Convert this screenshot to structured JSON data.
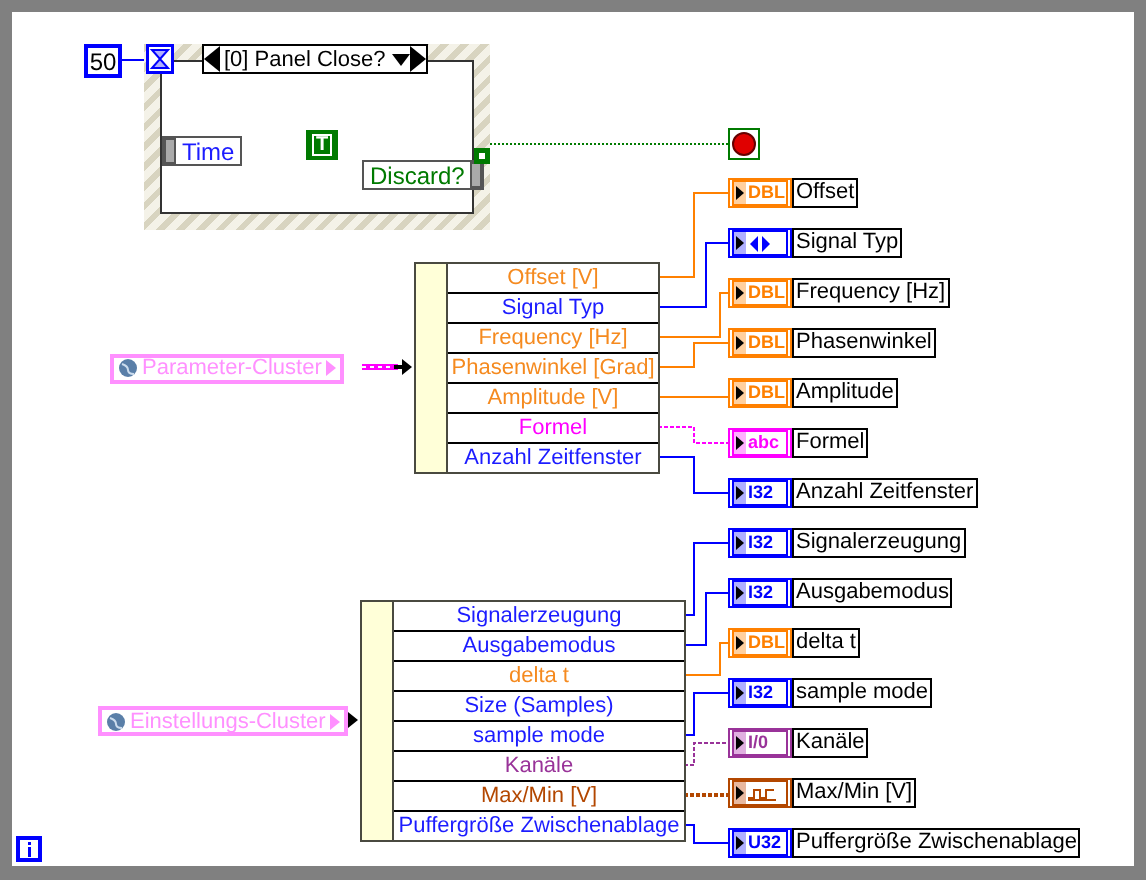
{
  "event_structure": {
    "timeout": "50",
    "case": "[0] Panel Close?",
    "left_data": "Time",
    "right_data": "Discard?",
    "constant": "T"
  },
  "groups": [
    {
      "source": "Parameter-Cluster",
      "elements": [
        {
          "label": "Offset [V]",
          "kind": "dbl",
          "indicator": {
            "label": "Offset",
            "type": "DBL"
          }
        },
        {
          "label": "Signal Typ",
          "kind": "enum",
          "indicator": {
            "label": "Signal Typ"
          }
        },
        {
          "label": "Frequency [Hz]",
          "kind": "dbl",
          "indicator": {
            "label": "Frequency [Hz]",
            "type": "DBL"
          }
        },
        {
          "label": "Phasenwinkel [Grad]",
          "kind": "dbl",
          "indicator": {
            "label": "Phasenwinkel",
            "type": "DBL"
          }
        },
        {
          "label": "Amplitude [V]",
          "kind": "dbl",
          "indicator": {
            "label": "Amplitude",
            "type": "DBL"
          }
        },
        {
          "label": "Formel",
          "kind": "string",
          "indicator": {
            "label": "Formel",
            "type": "abc"
          }
        },
        {
          "label": "Anzahl Zeitfenster",
          "kind": "i32",
          "indicator": {
            "label": "Anzahl Zeitfenster",
            "type": "I32"
          }
        }
      ]
    },
    {
      "source": "Einstellungs-Cluster",
      "elements": [
        {
          "label": "Signalerzeugung",
          "kind": "i32",
          "indicator": {
            "label": "Signalerzeugung",
            "type": "I32"
          }
        },
        {
          "label": "Ausgabemodus",
          "kind": "i32",
          "indicator": {
            "label": "Ausgabemodus",
            "type": "I32"
          }
        },
        {
          "label": "delta t",
          "kind": "dbl",
          "indicator": {
            "label": "delta t",
            "type": "DBL"
          }
        },
        {
          "label": "Size (Samples)",
          "kind": "i32"
        },
        {
          "label": "sample mode",
          "kind": "i32",
          "indicator": {
            "label": "sample mode",
            "type": "I32"
          }
        },
        {
          "label": "Kanäle",
          "kind": "io",
          "indicator": {
            "label": "Kanäle",
            "type": "I/0"
          }
        },
        {
          "label": "Max/Min [V]",
          "kind": "waveform",
          "indicator": {
            "label": "Max/Min [V]"
          }
        },
        {
          "label": "Puffergröße Zwischenablage",
          "kind": "u32",
          "indicator": {
            "label": "Puffergröße Zwischenablage",
            "type": "U32"
          }
        }
      ]
    }
  ]
}
